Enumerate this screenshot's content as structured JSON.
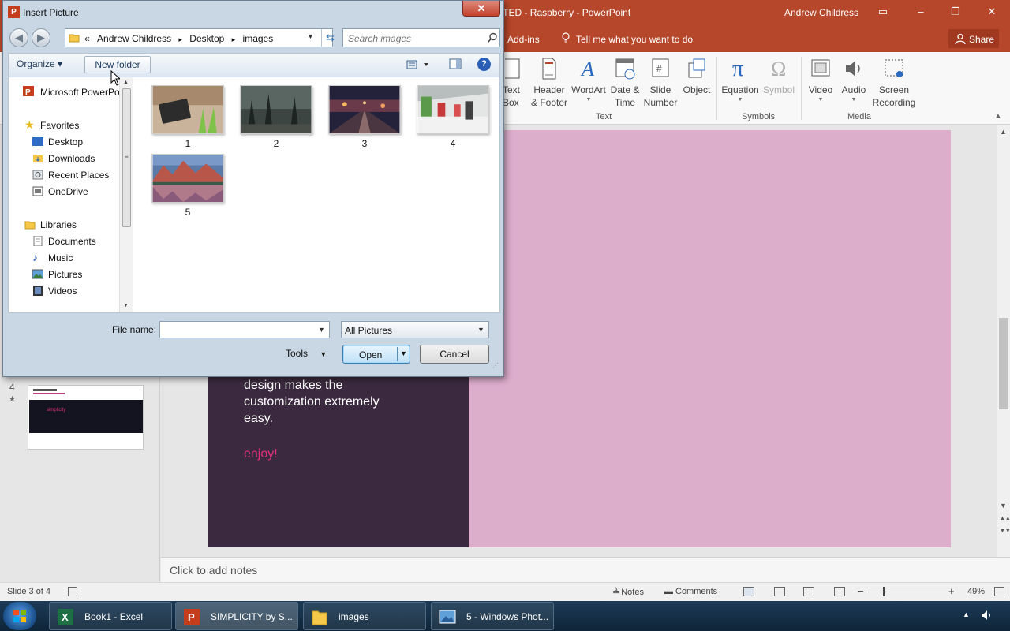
{
  "ppt": {
    "title": "ANIMATED - Raspberry  -  PowerPoint",
    "user": "Andrew Childress",
    "tabs": {
      "addins": "Add-ins",
      "tellme": "Tell me what you want to do"
    },
    "share": "Share",
    "ribbon": {
      "text_group": {
        "label": "Text",
        "textbox": "Text\nBox",
        "header_footer": "Header\n& Footer",
        "wordart": "WordArt",
        "date_time": "Date &\nTime",
        "slide_number": "Slide\nNumber",
        "object": "Object"
      },
      "symbols_group": {
        "label": "Symbols",
        "equation": "Equation",
        "symbol": "Symbol"
      },
      "media_group": {
        "label": "Media",
        "video": "Video",
        "audio": "Audio",
        "screen_recording": "Screen\nRecording"
      }
    },
    "thumbnail": {
      "number": "4",
      "star": "★",
      "logo": "simplicity"
    },
    "slide": {
      "body": "design makes the\ncustomization extremely\neasy.",
      "enjoy": "enjoy!"
    },
    "notes_placeholder": "Click to add notes",
    "status": {
      "slide": "Slide 3 of 4",
      "notes": "Notes",
      "comments": "Comments",
      "zoom": "49%",
      "zoom_level_fraction": 0.2
    },
    "colors": {
      "accent": "#b7472a",
      "slide_dark": "#3b2a3f",
      "slide_pink": "#ddadcc",
      "enjoy": "#e0307a"
    }
  },
  "taskbar": {
    "items": [
      {
        "label": "Book1 - Excel"
      },
      {
        "label": "SIMPLICITY by S..."
      },
      {
        "label": "images"
      },
      {
        "label": "5 - Windows Phot..."
      }
    ]
  },
  "dialog": {
    "title": "Insert Picture",
    "app_icon": "P",
    "close": "✕",
    "breadcrumb": {
      "overflow": "«",
      "parts": [
        "Andrew Childress",
        "Desktop",
        "images"
      ],
      "separator": "▸"
    },
    "search_placeholder": "Search images",
    "toolbar": {
      "organize": "Organize ▾",
      "new_folder": "New folder",
      "help": "?"
    },
    "nav": {
      "app": "Microsoft PowerPo",
      "favorites": "Favorites",
      "desktop": "Desktop",
      "downloads": "Downloads",
      "recent": "Recent Places",
      "onedrive": "OneDrive",
      "libraries": "Libraries",
      "documents": "Documents",
      "music": "Music",
      "pictures": "Pictures",
      "videos": "Videos"
    },
    "files": [
      {
        "name": "1"
      },
      {
        "name": "2"
      },
      {
        "name": "3"
      },
      {
        "name": "4"
      },
      {
        "name": "5"
      }
    ],
    "filename_label": "File name:",
    "filename_value": "",
    "filetype": "All Pictures",
    "tools": "Tools",
    "open": "Open",
    "cancel": "Cancel"
  }
}
